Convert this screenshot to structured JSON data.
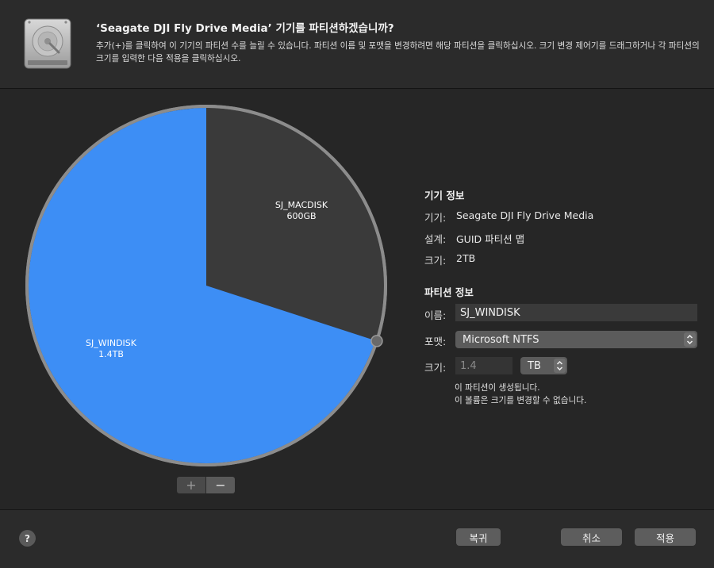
{
  "header": {
    "title": "‘Seagate DJI Fly Drive Media’ 기기를 파티션하겠습니까?",
    "description": "추가(+)를 클릭하여 이 기기의 파티션 수를 늘릴 수 있습니다. 파티션 이름 및 포맷을 변경하려면 해당 파티션을 클릭하십시오. 크기 변경 제어기를 드래그하거나 각 파티션의 크기를 입력한 다음 적용을 클릭하십시오."
  },
  "partitions": [
    {
      "name": "SJ_MACDISK",
      "size": "600GB",
      "fraction": 0.3,
      "color": "#3a3a3a"
    },
    {
      "name": "SJ_WINDISK",
      "size": "1.4TB",
      "fraction": 0.7,
      "color": "#3d8ef5"
    }
  ],
  "pie_controls": {
    "add": "+",
    "remove": "−"
  },
  "device_info": {
    "title": "기기 정보",
    "device_label": "기기:",
    "device_value": "Seagate DJI Fly Drive Media",
    "scheme_label": "설계:",
    "scheme_value": "GUID 파티션 맵",
    "size_label": "크기:",
    "size_value": "2TB"
  },
  "partition_info": {
    "title": "파티션 정보",
    "name_label": "이름:",
    "name_value": "SJ_WINDISK",
    "format_label": "포맷:",
    "format_value": "Microsoft NTFS",
    "size_label": "크기:",
    "size_value": "1.4",
    "unit_value": "TB",
    "note_line1": "이 파티션이 생성됩니다.",
    "note_line2": "이 볼륨은 크기를 변경할 수 없습니다."
  },
  "footer": {
    "help": "?",
    "revert": "복귀",
    "cancel": "취소",
    "apply": "적용"
  },
  "icons": {
    "disk": "hard-drive-icon",
    "popup": "chevron-up-down-icon"
  }
}
